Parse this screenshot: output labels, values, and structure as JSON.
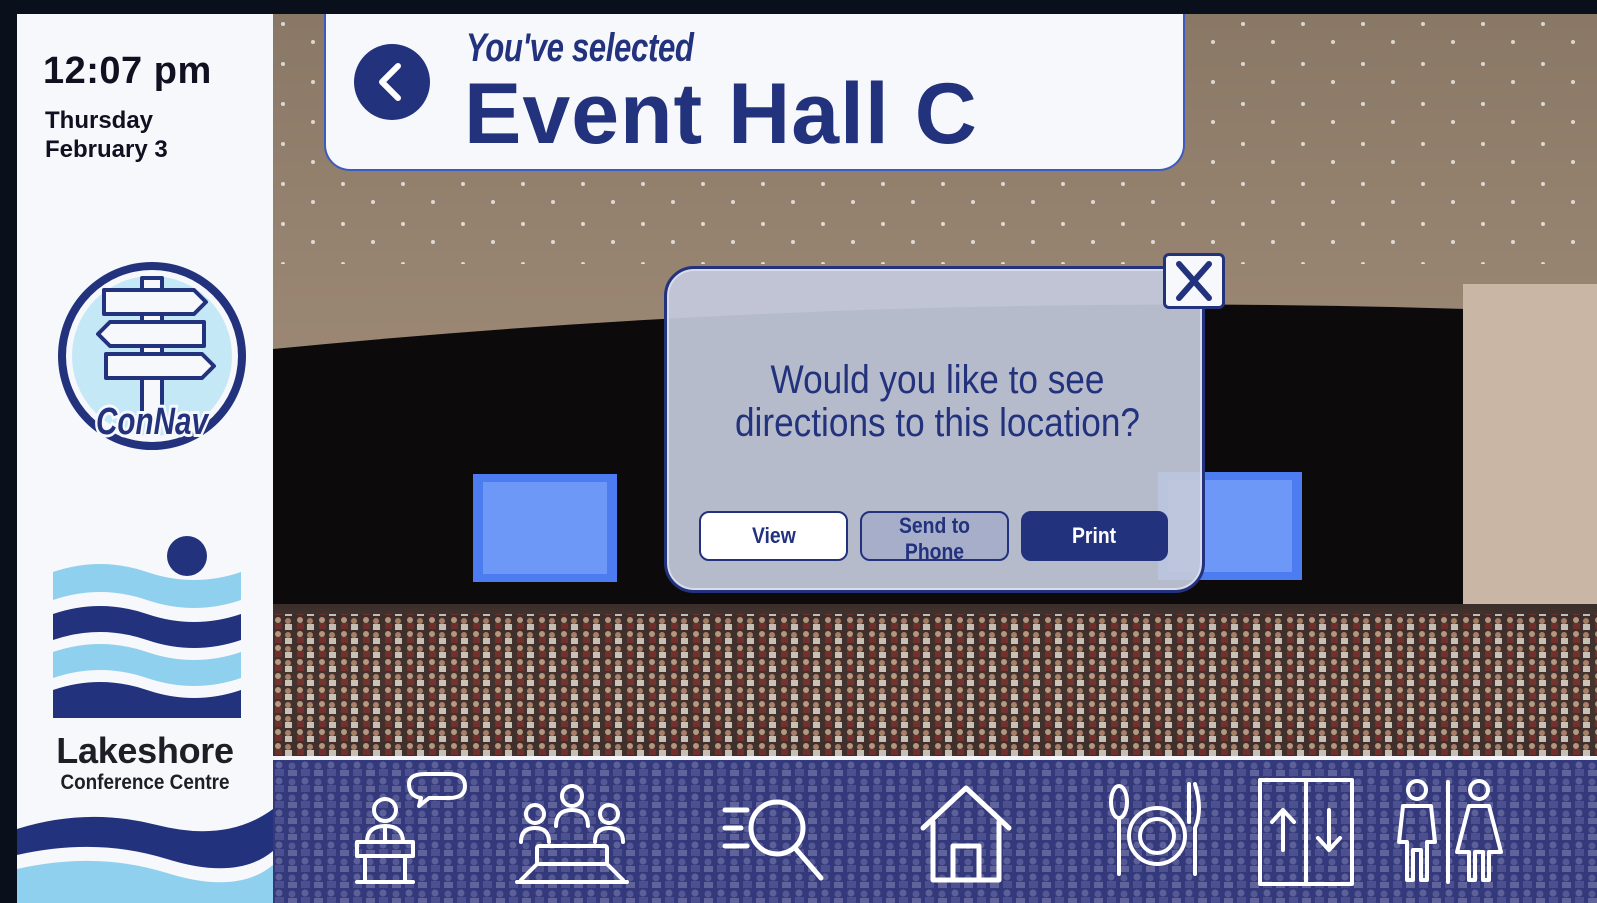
{
  "sidebar": {
    "time": "12:07 pm",
    "weekday": "Thursday",
    "date": "February 3",
    "app_logo_text": "ConNav",
    "venue_name": "Lakeshore",
    "venue_subtitle": "Conference Centre"
  },
  "header": {
    "selected_label": "You've selected",
    "location_name": "Event Hall C",
    "back_icon": "chevron-left-icon"
  },
  "dialog": {
    "question_line1": "Would you like to see",
    "question_line2": "directions to this location?",
    "close_icon": "close-icon",
    "buttons": {
      "view": "View",
      "send_to_phone": "Send to Phone",
      "print": "Print"
    }
  },
  "bottom_nav": {
    "items": [
      {
        "icon": "speaker-podium-icon"
      },
      {
        "icon": "meeting-room-icon"
      },
      {
        "icon": "search-list-icon"
      },
      {
        "icon": "home-icon"
      },
      {
        "icon": "dining-icon"
      },
      {
        "icon": "elevator-icon"
      },
      {
        "icon": "restrooms-icon"
      }
    ]
  },
  "colors": {
    "brand_navy": "#23327d",
    "accent_blue": "#3c5bc0",
    "panel_white": "#f7f8fc",
    "water_light": "#8fd0ef",
    "nav_bar": "#34397b"
  }
}
